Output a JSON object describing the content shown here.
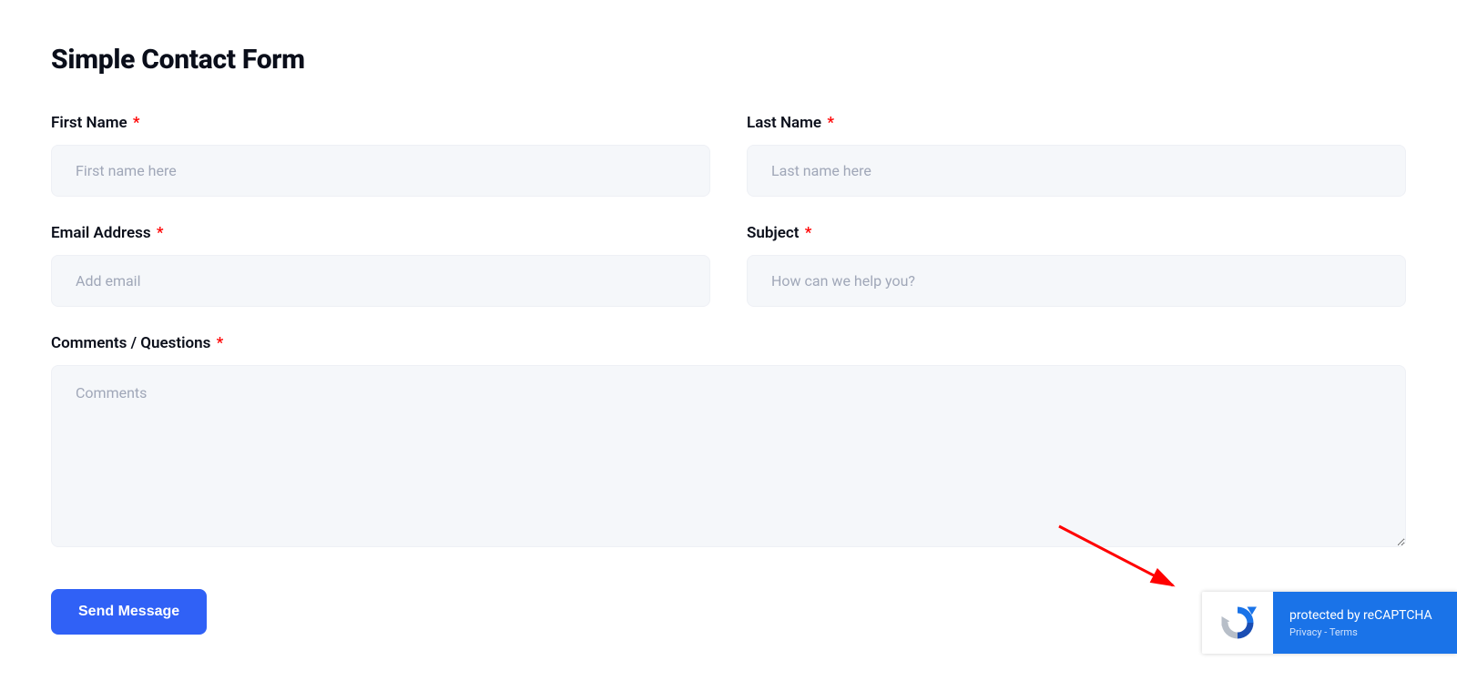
{
  "page": {
    "title": "Simple Contact Form"
  },
  "form": {
    "first_name": {
      "label": "First Name",
      "required": "*",
      "placeholder": "First name here",
      "value": ""
    },
    "last_name": {
      "label": "Last Name",
      "required": "*",
      "placeholder": "Last name here",
      "value": ""
    },
    "email": {
      "label": "Email Address",
      "required": "*",
      "placeholder": "Add email",
      "value": ""
    },
    "subject": {
      "label": "Subject",
      "required": "*",
      "placeholder": "How can we help you?",
      "value": ""
    },
    "comments": {
      "label": "Comments / Questions",
      "required": "*",
      "placeholder": "Comments",
      "value": ""
    },
    "submit_label": "Send Message"
  },
  "recaptcha": {
    "title": "protected by reCAPTCHA",
    "privacy_label": "Privacy",
    "separator": " - ",
    "terms_label": "Terms"
  }
}
